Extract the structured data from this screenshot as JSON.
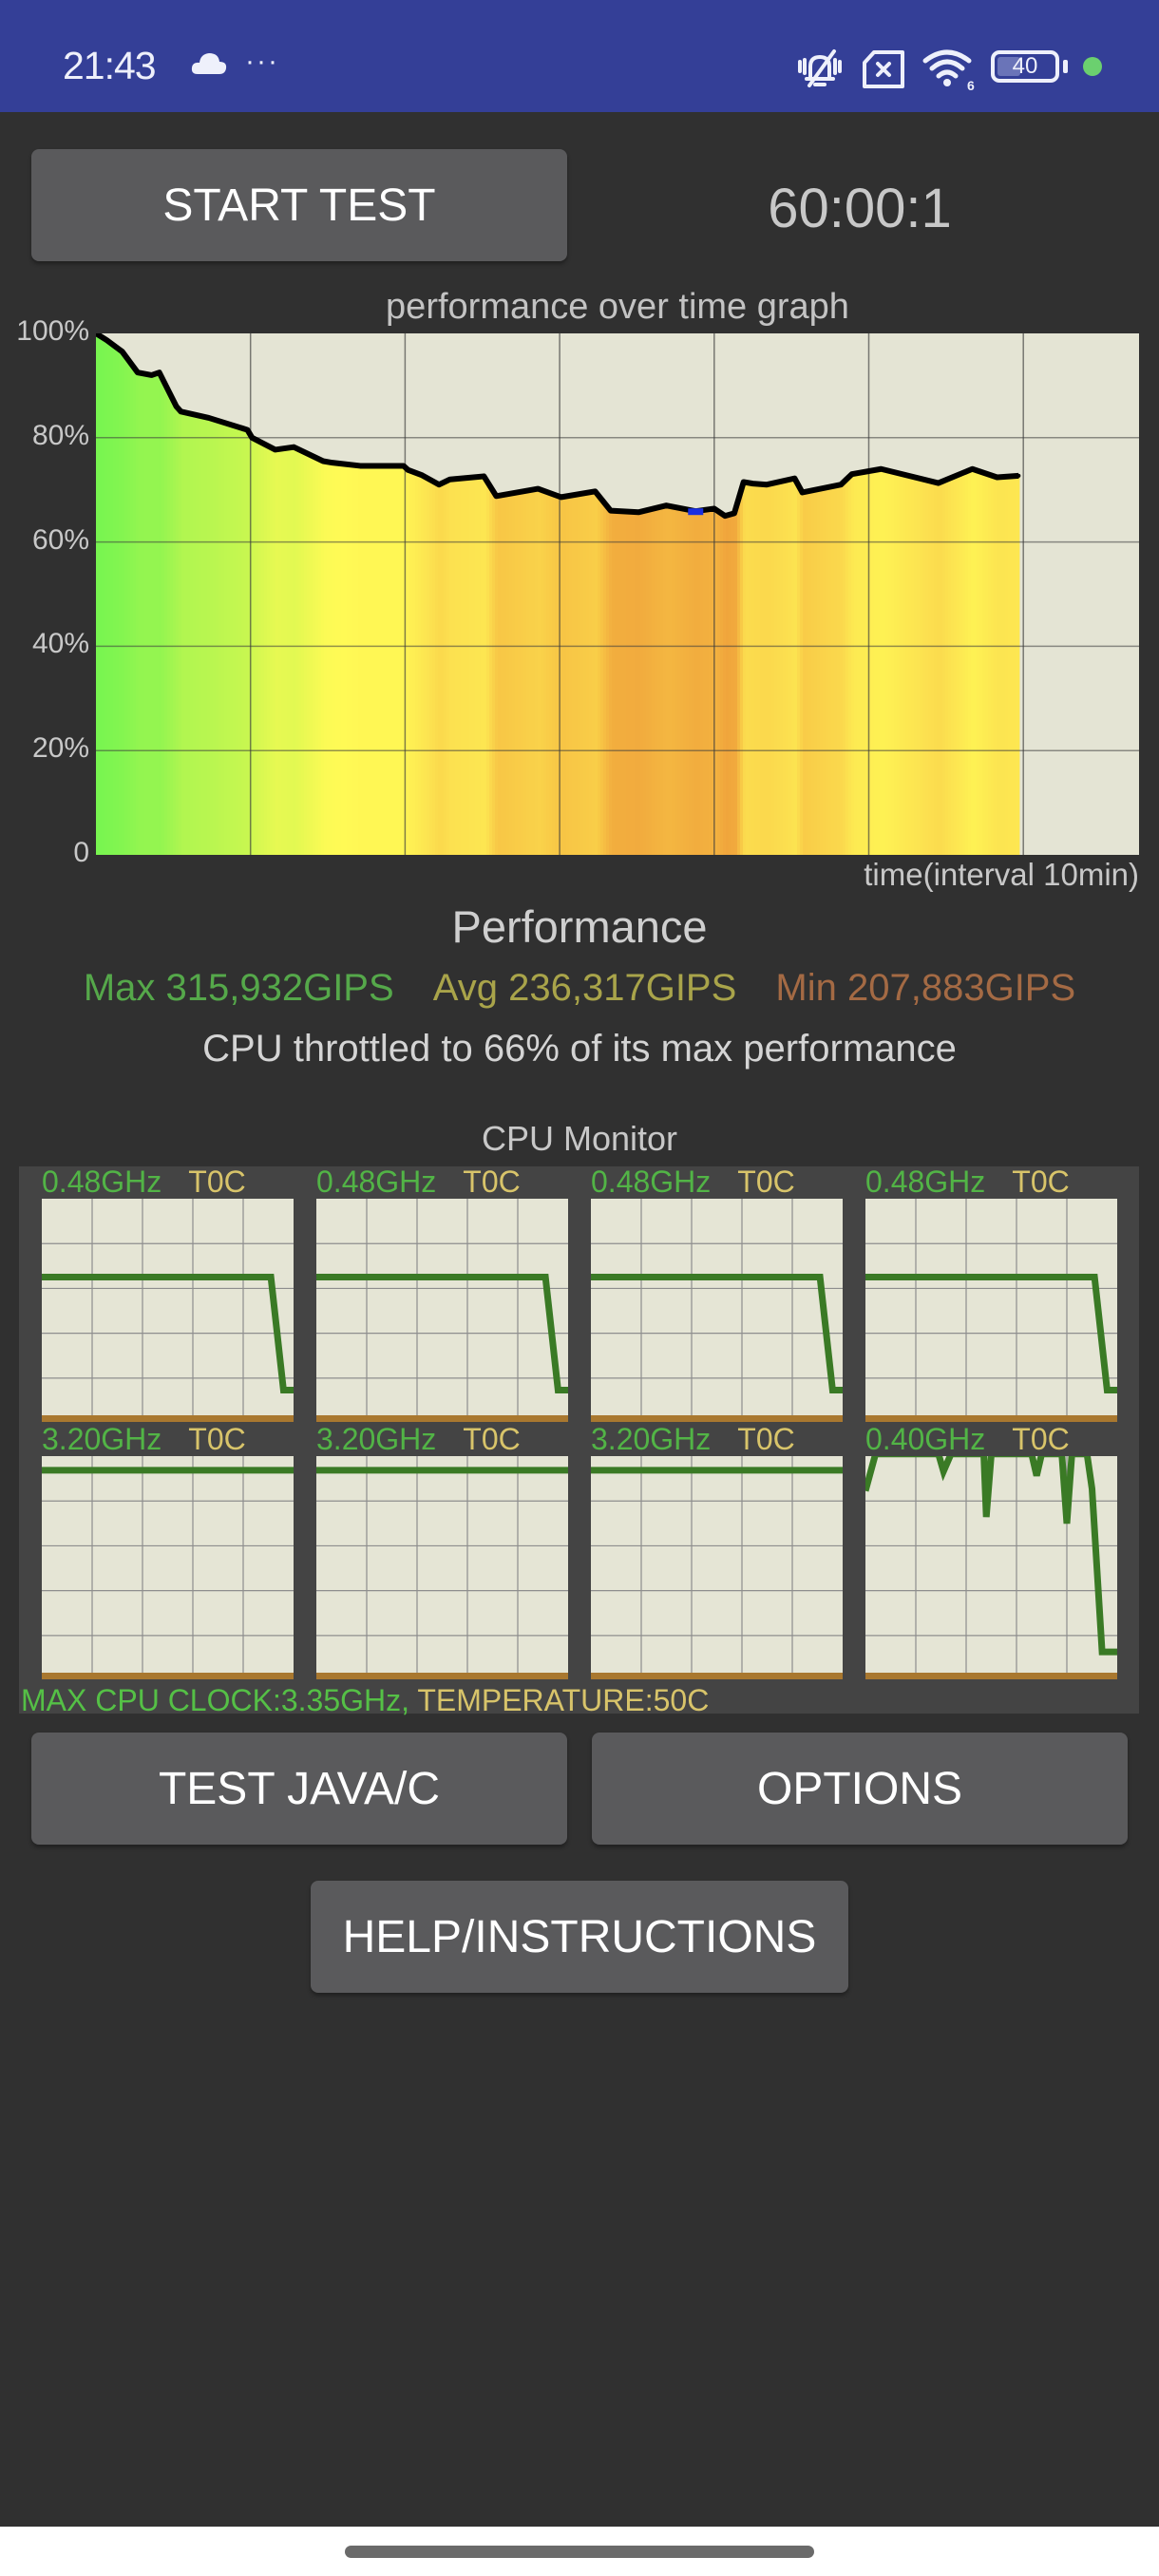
{
  "status_bar": {
    "time": "21:43",
    "notification_icons": [
      "cloud-icon",
      "more-dots-icon"
    ],
    "more_dots": "···",
    "system_icons": [
      "silent-bell-icon",
      "no-sim-icon",
      "wifi-6-icon",
      "battery-icon",
      "privacy-dot-icon"
    ],
    "wifi_badge": "6",
    "battery_level": "40",
    "privacy_dot_color": "#6bd06f",
    "background_color": "#343f97"
  },
  "controls": {
    "start_button": "START TEST",
    "timer": "60:00:1"
  },
  "chart_data": {
    "type": "area",
    "title": "performance over time graph",
    "xlabel": "time(interval 10min)",
    "ylabel": "",
    "y_tick_labels": [
      "0",
      "20%",
      "40%",
      "60%",
      "80%",
      "100%"
    ],
    "y_ticks": [
      0,
      20,
      40,
      60,
      80,
      100
    ],
    "ylim": [
      0,
      100
    ],
    "x_interval_minutes": 10,
    "xlim_minutes": [
      0,
      67.5
    ],
    "grid": true,
    "x_minutes": [
      0,
      0.7,
      1.7,
      2.7,
      3.6,
      4.1,
      5.2,
      5.5,
      7.3,
      9.8,
      10.1,
      11.6,
      12.8,
      14.7,
      15.3,
      17.1,
      18.7,
      19.9,
      20.2,
      21.1,
      22.2,
      22.9,
      25.1,
      25.9,
      28.6,
      30.1,
      32.3,
      33.3,
      35.1,
      36.9,
      38.8,
      40.0,
      40.7,
      41.3,
      41.9,
      42.5,
      43.4,
      45.2,
      45.7,
      48.2,
      48.9,
      50.8,
      54.5,
      56.7,
      58.3,
      59.7
    ],
    "performance_pct": [
      100,
      98.7,
      96.5,
      92.5,
      92,
      92.5,
      86,
      85,
      83.8,
      81.5,
      80,
      77.7,
      78.2,
      75.5,
      75.2,
      74.6,
      74.6,
      74.6,
      73.8,
      72.8,
      71,
      72,
      72.6,
      68.8,
      70.2,
      68.6,
      69.7,
      66,
      65.7,
      67,
      65.9,
      66.4,
      65,
      65.5,
      71.5,
      71.2,
      71,
      72.2,
      69.5,
      71,
      73,
      74,
      71.3,
      74,
      72.4,
      72.7
    ],
    "min_marker_minutes": 38.8,
    "min_marker_color": "#1a2ee0",
    "line_color": "#000000",
    "fill_gradient": "green (high) to orange (low) per sample"
  },
  "performance": {
    "title": "Performance",
    "max_label": "Max 315,932GIPS",
    "avg_label": "Avg 236,317GIPS",
    "min_label": "Min 207,883GIPS",
    "max_color": "#55a84a",
    "avg_color": "#a9a44a",
    "min_color": "#a46a44",
    "throttle_text": "CPU throttled to 66% of its max performance"
  },
  "cpu_monitor": {
    "title": "CPU Monitor",
    "cores": [
      {
        "freq": "0.48GHz",
        "temp": "T0C",
        "level_pct": [
          64,
          64,
          64,
          64,
          64,
          64,
          64,
          64,
          64,
          64,
          12,
          12
        ],
        "level_x": [
          0,
          0.1,
          0.2,
          0.3,
          0.4,
          0.5,
          0.6,
          0.7,
          0.8,
          0.91,
          0.96,
          1.0
        ]
      },
      {
        "freq": "0.48GHz",
        "temp": "T0C",
        "level_pct": [
          64,
          64,
          64,
          12,
          12
        ],
        "level_x": [
          0,
          0.91,
          0.91,
          0.96,
          1.0
        ]
      },
      {
        "freq": "0.48GHz",
        "temp": "T0C",
        "level_pct": [
          64,
          64,
          12,
          12
        ],
        "level_x": [
          0,
          0.91,
          0.96,
          1.0
        ]
      },
      {
        "freq": "0.48GHz",
        "temp": "T0C",
        "level_pct": [
          64,
          64,
          12,
          12
        ],
        "level_x": [
          0,
          0.91,
          0.96,
          1.0
        ]
      },
      {
        "freq": "3.20GHz",
        "temp": "T0C",
        "level_pct": [
          93.5,
          93.5
        ],
        "level_x": [
          0,
          1.0
        ]
      },
      {
        "freq": "3.20GHz",
        "temp": "T0C",
        "level_pct": [
          93.5,
          93.5
        ],
        "level_x": [
          0,
          1.0
        ]
      },
      {
        "freq": "3.20GHz",
        "temp": "T0C",
        "level_pct": [
          93.5,
          93.5
        ],
        "level_x": [
          0,
          1.0
        ]
      },
      {
        "freq": "0.40GHz",
        "temp": "T0C",
        "level_pct": [
          84,
          101,
          101,
          101,
          93,
          101,
          101,
          101,
          72,
          101,
          101,
          101,
          91,
          101,
          101,
          69,
          101,
          101,
          101,
          85,
          10,
          10
        ],
        "level_x": [
          0,
          0.04,
          0.2,
          0.29,
          0.31,
          0.34,
          0.46,
          0.47,
          0.48,
          0.5,
          0.61,
          0.66,
          0.68,
          0.7,
          0.78,
          0.8,
          0.82,
          0.86,
          0.88,
          0.9,
          0.94,
          1.0
        ]
      }
    ],
    "footer_clock": "MAX CPU CLOCK:3.35GHz,",
    "footer_temp": " TEMPERATURE:50C",
    "line_color": "#3a7a25",
    "base_bar_color": "#a9782f"
  },
  "buttons": {
    "test_java_c": "TEST JAVA/C",
    "options": "OPTIONS",
    "help": "HELP/INSTRUCTIONS"
  }
}
